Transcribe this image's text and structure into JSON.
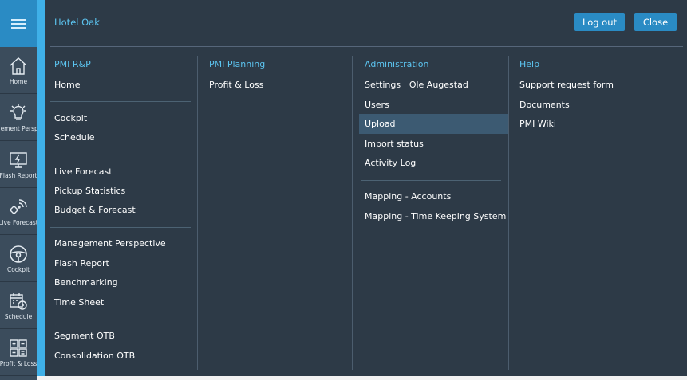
{
  "sidebar": {
    "items": [
      {
        "label": "Home",
        "icon": "home-icon"
      },
      {
        "label": "Management Perspective",
        "icon": "lightbulb-icon"
      },
      {
        "label": "Flash Report",
        "icon": "flash-report-icon"
      },
      {
        "label": "Live Forecast",
        "icon": "live-forecast-icon"
      },
      {
        "label": "Cockpit",
        "icon": "steering-wheel-icon"
      },
      {
        "label": "Schedule",
        "icon": "calendar-clock-icon"
      },
      {
        "label": "Profit & Loss",
        "icon": "calculator-icon"
      }
    ]
  },
  "header": {
    "hotel_name": "Hotel Oak",
    "logout_label": "Log out",
    "close_label": "Close"
  },
  "columns": {
    "rp": {
      "title": "PMI R&P",
      "groups": [
        [
          "Home"
        ],
        [
          "Cockpit",
          "Schedule"
        ],
        [
          "Live Forecast",
          "Pickup Statistics",
          "Budget & Forecast"
        ],
        [
          "Management Perspective",
          "Flash Report",
          "Benchmarking",
          "Time Sheet"
        ],
        [
          "Segment OTB",
          "Consolidation OTB"
        ]
      ]
    },
    "planning": {
      "title": "PMI Planning",
      "groups": [
        [
          "Profit & Loss"
        ]
      ]
    },
    "admin": {
      "title": "Administration",
      "active": "Upload",
      "groups": [
        [
          "Settings | Ole Augestad",
          "Users",
          "Upload",
          "Import status",
          "Activity Log"
        ],
        [
          "Mapping - Accounts",
          "Mapping - Time Keeping System"
        ]
      ]
    },
    "help": {
      "title": "Help",
      "groups": [
        [
          "Support request form",
          "Documents",
          "PMI Wiki"
        ]
      ]
    }
  },
  "colors": {
    "background": "#2d3a47",
    "sidebar": "#3b4c5c",
    "accent": "#3fb0e8",
    "button": "#2a8bc4",
    "heading": "#5cc4f0",
    "active_item": "#3c5a72"
  }
}
